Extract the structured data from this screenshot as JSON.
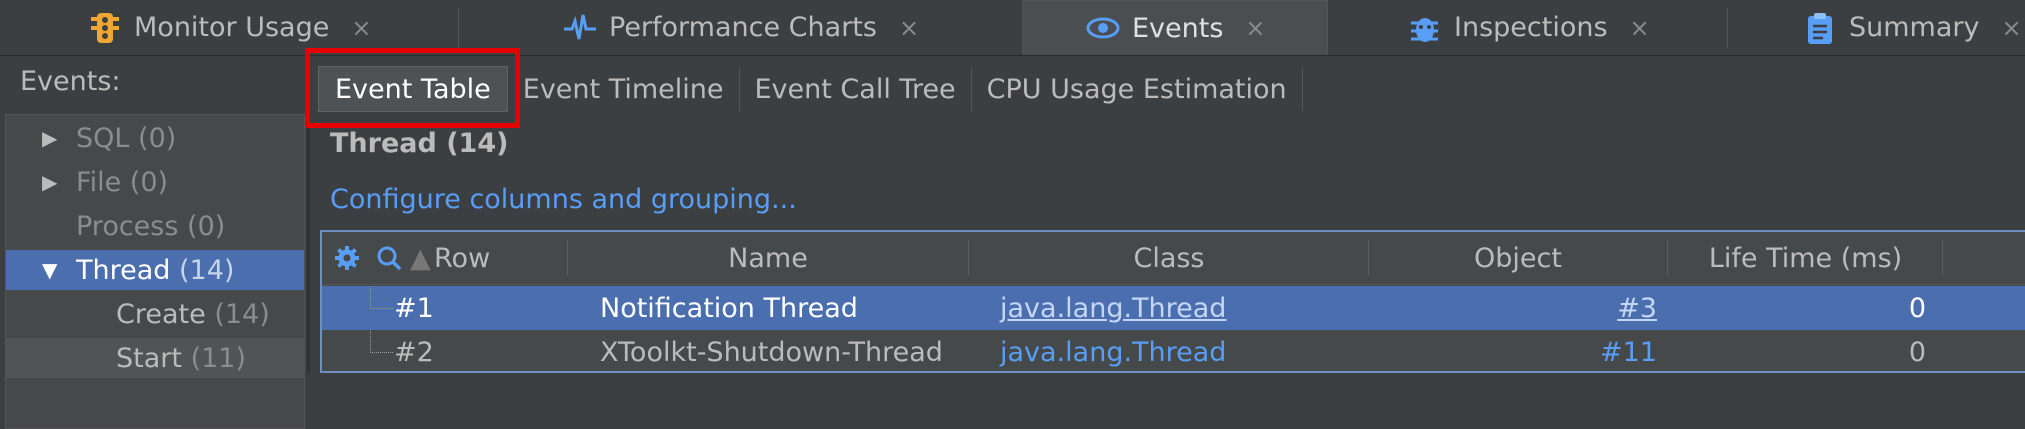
{
  "tabs": [
    {
      "label": "Monitor Usage",
      "icon": "traffic-light-icon"
    },
    {
      "label": "Performance Charts",
      "icon": "pulse-icon"
    },
    {
      "label": "Events",
      "icon": "eye-icon",
      "active": true
    },
    {
      "label": "Inspections",
      "icon": "bug-icon"
    },
    {
      "label": "Summary",
      "icon": "clipboard-icon"
    }
  ],
  "close_glyph": "×",
  "events_label": "Events:",
  "tree": [
    {
      "label": "SQL",
      "count": "(0)"
    },
    {
      "label": "File",
      "count": "(0)"
    },
    {
      "label": "Process",
      "count": "(0)"
    },
    {
      "label": "Thread",
      "count": "(14)",
      "selected": true
    },
    {
      "label": "Create",
      "count": "(14)"
    },
    {
      "label": "Start",
      "count": "(11)"
    }
  ],
  "subtabs": [
    "Event Table",
    "Event Timeline",
    "Event Call Tree",
    "CPU Usage Estimation"
  ],
  "section_title": "Thread (14)",
  "configure_link": "Configure columns and grouping...",
  "columns": [
    "Row",
    "Name",
    "Class",
    "Object",
    "Life Time (ms)"
  ],
  "rows": [
    {
      "row": "#1",
      "name": "Notification Thread",
      "class": "java.lang.Thread",
      "object": "#3",
      "lifetime": "0"
    },
    {
      "row": "#2",
      "name": "XToolkt-Shutdown-Thread",
      "class": "java.lang.Thread",
      "object": "#11",
      "lifetime": "0"
    }
  ],
  "colors": {
    "accent": "#4b6eaf",
    "link": "#589df6",
    "highlight": "#e60000"
  }
}
